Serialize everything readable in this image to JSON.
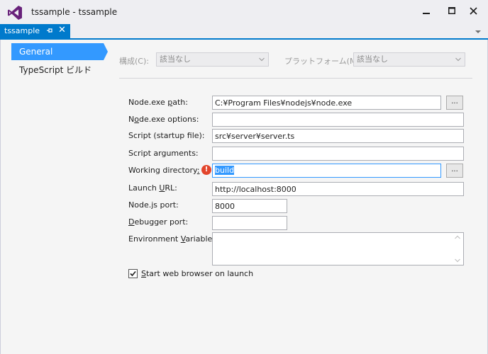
{
  "window": {
    "title": "tssample - tssample",
    "minimize": "▁",
    "maximize": "□",
    "close": "✕"
  },
  "tab": {
    "label": "tssample",
    "close": "✕"
  },
  "nav": {
    "items": [
      {
        "label": "General",
        "selected": true
      },
      {
        "label": "TypeScript ビルド",
        "selected": false
      }
    ]
  },
  "config": {
    "configuration_label": "構成(C):",
    "configuration_value": "該当なし",
    "platform_label": "プラットフォーム(M):",
    "platform_value": "該当なし"
  },
  "form": {
    "node_path_label_pre": "Node.exe ",
    "node_path_label_key": "p",
    "node_path_label_post": "ath:",
    "node_path_value": "C:¥Program Files¥nodejs¥node.exe",
    "node_options_label_pre": "N",
    "node_options_label_key": "o",
    "node_options_label_post": "de.exe options:",
    "node_options_value": "",
    "script_label": "Script (startup file):",
    "script_value": "src¥server¥server.ts",
    "script_args_label": "Script arguments:",
    "script_args_value": "",
    "working_dir_label_pre": "Working directory",
    "working_dir_label_key": ":",
    "working_dir_value": "build",
    "launch_url_label_pre": "Launch ",
    "launch_url_label_key": "U",
    "launch_url_label_post": "RL:",
    "launch_url_value": "http://localhost:8000",
    "node_port_label": "Node.js port:",
    "node_port_value": "8000",
    "debugger_port_label_key": "D",
    "debugger_port_label_post": "ebugger port:",
    "debugger_port_value": "",
    "env_vars_label_pre": "Environment ",
    "env_vars_label_key": "V",
    "env_vars_label_post": "ariables:",
    "env_vars_value": "",
    "browse_label": "...",
    "error_glyph": "!",
    "start_browser_label_key": "S",
    "start_browser_label_post": "tart web browser on launch",
    "start_browser_checked": true
  },
  "colors": {
    "accent": "#007acc",
    "selection": "#3399ff",
    "error": "#e2452c",
    "logo": "#68217a"
  }
}
